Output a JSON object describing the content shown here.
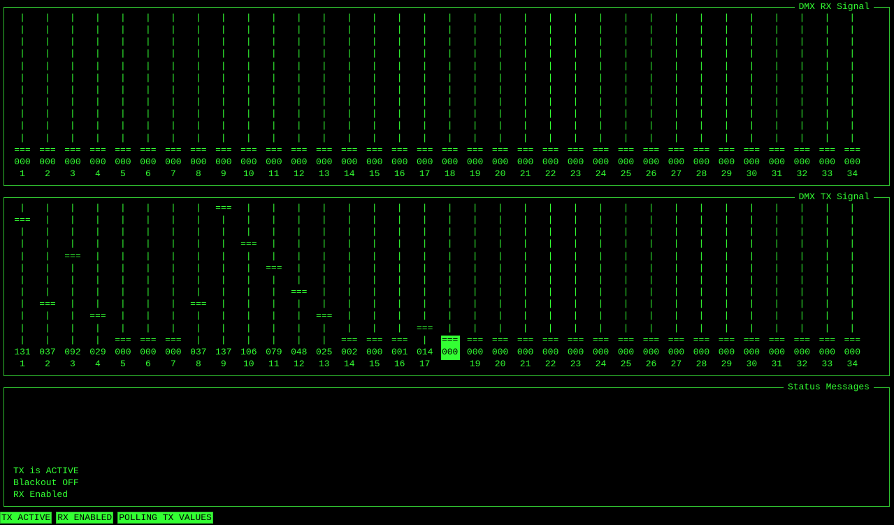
{
  "rx_panel": {
    "title": "DMX RX Signal",
    "values": [
      "000",
      "000",
      "000",
      "000",
      "000",
      "000",
      "000",
      "000",
      "000",
      "000",
      "000",
      "000",
      "000",
      "000",
      "000",
      "000",
      "000",
      "000",
      "000",
      "000",
      "000",
      "000",
      "000",
      "000",
      "000",
      "000",
      "000",
      "000",
      "000",
      "000",
      "000",
      "000",
      "000",
      "000"
    ],
    "levels": [
      0,
      0,
      0,
      0,
      0,
      0,
      0,
      0,
      0,
      0,
      0,
      0,
      0,
      0,
      0,
      0,
      0,
      0,
      0,
      0,
      0,
      0,
      0,
      0,
      0,
      0,
      0,
      0,
      0,
      0,
      0,
      0,
      0,
      0
    ]
  },
  "tx_panel": {
    "title": "DMX TX Signal",
    "values": [
      "131",
      "037",
      "092",
      "029",
      "000",
      "000",
      "000",
      "037",
      "137",
      "106",
      "079",
      "048",
      "025",
      "002",
      "000",
      "001",
      "014",
      "000",
      "000",
      "000",
      "000",
      "000",
      "000",
      "000",
      "000",
      "000",
      "000",
      "000",
      "000",
      "000",
      "000",
      "000",
      "000",
      "000"
    ],
    "levels": [
      131,
      37,
      92,
      29,
      0,
      0,
      0,
      37,
      137,
      106,
      79,
      48,
      25,
      2,
      0,
      1,
      14,
      0,
      0,
      0,
      0,
      0,
      0,
      0,
      0,
      0,
      0,
      0,
      0,
      0,
      0,
      0,
      0,
      0
    ],
    "selected_channel": 18
  },
  "channels": [
    "1",
    "2",
    "3",
    "4",
    "5",
    "6",
    "7",
    "8",
    "9",
    "10",
    "11",
    "12",
    "13",
    "14",
    "15",
    "16",
    "17",
    "18",
    "19",
    "20",
    "21",
    "22",
    "23",
    "24",
    "25",
    "26",
    "27",
    "28",
    "29",
    "30",
    "31",
    "32",
    "33",
    "34"
  ],
  "glyphs": {
    "tick": "|",
    "bar": "==="
  },
  "status_panel": {
    "title": "Status Messages",
    "lines": [
      "TX is ACTIVE",
      "Blackout OFF",
      "RX Enabled"
    ]
  },
  "statusbar": {
    "items": [
      "TX ACTIVE",
      "RX ENABLED",
      "POLLING TX VALUES"
    ]
  },
  "colors": {
    "foreground": "#33ff33",
    "background": "#000000"
  }
}
